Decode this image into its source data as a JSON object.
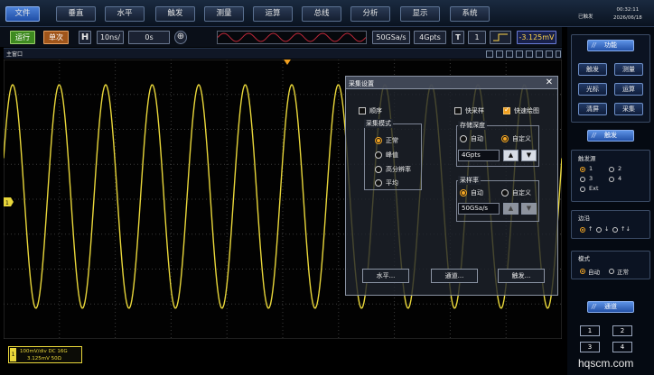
{
  "menu": [
    {
      "label": "文件",
      "active": true
    },
    {
      "label": "垂直"
    },
    {
      "label": "水平"
    },
    {
      "label": "触发"
    },
    {
      "label": "测量"
    },
    {
      "label": "运算"
    },
    {
      "label": "总线"
    },
    {
      "label": "分析"
    },
    {
      "label": "显示"
    },
    {
      "label": "系统"
    }
  ],
  "status": {
    "state": "已触发",
    "time": "00:32:11",
    "date": "2026/06/18"
  },
  "toolbar": {
    "run": "运行",
    "single": "单次",
    "h": "H",
    "timebase": "10ns/",
    "offset": "0s",
    "plus": "⊕",
    "sample_rate": "50GSa/s",
    "depth": "4Gpts",
    "trig_t": "T",
    "trig_channel": "1",
    "trig_level": "-3.125mV"
  },
  "main_window": {
    "title": "主窗口"
  },
  "channel_info": {
    "num": "1",
    "line1": "100mV/div    DC    16G",
    "line2": "3.125mV    50Ω"
  },
  "dialog": {
    "title": "采集设置",
    "close": "✕",
    "sequence_label": "顺序",
    "sequence_checked": false,
    "fast_sample_label": "快采样",
    "fast_sample_checked": false,
    "fast_draw_label": "快速绘图",
    "fast_draw_checked": true,
    "acq_mode": {
      "title": "采集模式",
      "options": [
        "正常",
        "峰值",
        "高分辨率",
        "平均"
      ],
      "selected": 0
    },
    "memory_depth": {
      "title": "存储深度",
      "auto": "自动",
      "custom": "自定义",
      "selected": "custom",
      "value": "4Gpts"
    },
    "sample_rate": {
      "title": "采样率",
      "auto": "自动",
      "custom": "自定义",
      "selected": "auto",
      "value": "50GSa/s"
    },
    "buttons": [
      "水平...",
      "通道...",
      "触发..."
    ]
  },
  "right_panel": {
    "function_title": "功能",
    "function_buttons": [
      "触发",
      "测量",
      "光标",
      "运算",
      "清屏",
      "采集"
    ],
    "trigger_title": "触发",
    "trigger_source": {
      "label": "触发源",
      "options": [
        "1",
        "2",
        "3",
        "4",
        "Ext"
      ],
      "selected": "1"
    },
    "edge": {
      "label": "边沿",
      "options": [
        "↑",
        "↓",
        "↑↓"
      ],
      "selected": "↑"
    },
    "mode": {
      "label": "模式",
      "options": [
        "自动",
        "正常"
      ],
      "selected": "自动"
    },
    "channel_title": "通道",
    "channels": [
      "1",
      "2",
      "3",
      "4"
    ]
  },
  "colors": {
    "trace": "#e8d63a",
    "accent": "#3d73cf",
    "trigger_marker": "#f0a020"
  },
  "waveform": {
    "type": "sine",
    "cycles_visible": 12,
    "amplitude_fraction": 0.8
  },
  "watermark": "hqscm.com"
}
